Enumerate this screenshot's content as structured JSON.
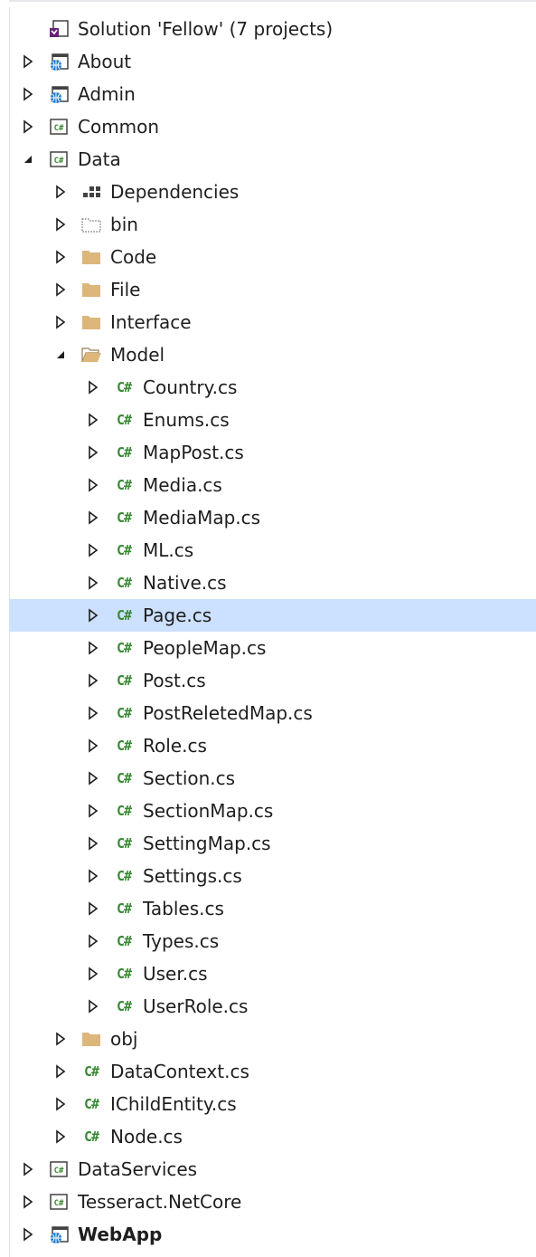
{
  "tree": {
    "items": [
      {
        "label": "Solution 'Fellow' (7 projects)",
        "level": 0,
        "expand": "none",
        "icon": "solution-icon",
        "bold": false,
        "selected": false
      },
      {
        "label": "About",
        "level": 0,
        "expand": "collapsed",
        "icon": "web-project-icon",
        "bold": false,
        "selected": false
      },
      {
        "label": "Admin",
        "level": 0,
        "expand": "collapsed",
        "icon": "web-project-icon",
        "bold": false,
        "selected": false
      },
      {
        "label": "Common",
        "level": 0,
        "expand": "collapsed",
        "icon": "csharp-project-icon",
        "bold": false,
        "selected": false
      },
      {
        "label": "Data",
        "level": 0,
        "expand": "expanded",
        "icon": "csharp-project-icon",
        "bold": false,
        "selected": false
      },
      {
        "label": "Dependencies",
        "level": 1,
        "expand": "collapsed",
        "icon": "dependencies-icon",
        "bold": false,
        "selected": false
      },
      {
        "label": "bin",
        "level": 1,
        "expand": "collapsed",
        "icon": "hidden-folder-icon",
        "bold": false,
        "selected": false
      },
      {
        "label": "Code",
        "level": 1,
        "expand": "collapsed",
        "icon": "folder-icon",
        "bold": false,
        "selected": false
      },
      {
        "label": "File",
        "level": 1,
        "expand": "collapsed",
        "icon": "folder-icon",
        "bold": false,
        "selected": false
      },
      {
        "label": "Interface",
        "level": 1,
        "expand": "collapsed",
        "icon": "folder-icon",
        "bold": false,
        "selected": false
      },
      {
        "label": "Model",
        "level": 1,
        "expand": "expanded",
        "icon": "folder-open-icon",
        "bold": false,
        "selected": false
      },
      {
        "label": "Country.cs",
        "level": 2,
        "expand": "collapsed",
        "icon": "csharp-file-icon",
        "bold": false,
        "selected": false
      },
      {
        "label": "Enums.cs",
        "level": 2,
        "expand": "collapsed",
        "icon": "csharp-file-icon",
        "bold": false,
        "selected": false
      },
      {
        "label": "MapPost.cs",
        "level": 2,
        "expand": "collapsed",
        "icon": "csharp-file-icon",
        "bold": false,
        "selected": false
      },
      {
        "label": "Media.cs",
        "level": 2,
        "expand": "collapsed",
        "icon": "csharp-file-icon",
        "bold": false,
        "selected": false
      },
      {
        "label": "MediaMap.cs",
        "level": 2,
        "expand": "collapsed",
        "icon": "csharp-file-icon",
        "bold": false,
        "selected": false
      },
      {
        "label": "ML.cs",
        "level": 2,
        "expand": "collapsed",
        "icon": "csharp-file-icon",
        "bold": false,
        "selected": false
      },
      {
        "label": "Native.cs",
        "level": 2,
        "expand": "collapsed",
        "icon": "csharp-file-icon",
        "bold": false,
        "selected": false
      },
      {
        "label": "Page.cs",
        "level": 2,
        "expand": "collapsed",
        "icon": "csharp-file-icon",
        "bold": false,
        "selected": true
      },
      {
        "label": "PeopleMap.cs",
        "level": 2,
        "expand": "collapsed",
        "icon": "csharp-file-icon",
        "bold": false,
        "selected": false
      },
      {
        "label": "Post.cs",
        "level": 2,
        "expand": "collapsed",
        "icon": "csharp-file-icon",
        "bold": false,
        "selected": false
      },
      {
        "label": "PostReletedMap.cs",
        "level": 2,
        "expand": "collapsed",
        "icon": "csharp-file-icon",
        "bold": false,
        "selected": false
      },
      {
        "label": "Role.cs",
        "level": 2,
        "expand": "collapsed",
        "icon": "csharp-file-icon",
        "bold": false,
        "selected": false
      },
      {
        "label": "Section.cs",
        "level": 2,
        "expand": "collapsed",
        "icon": "csharp-file-icon",
        "bold": false,
        "selected": false
      },
      {
        "label": "SectionMap.cs",
        "level": 2,
        "expand": "collapsed",
        "icon": "csharp-file-icon",
        "bold": false,
        "selected": false
      },
      {
        "label": "SettingMap.cs",
        "level": 2,
        "expand": "collapsed",
        "icon": "csharp-file-icon",
        "bold": false,
        "selected": false
      },
      {
        "label": "Settings.cs",
        "level": 2,
        "expand": "collapsed",
        "icon": "csharp-file-icon",
        "bold": false,
        "selected": false
      },
      {
        "label": "Tables.cs",
        "level": 2,
        "expand": "collapsed",
        "icon": "csharp-file-icon",
        "bold": false,
        "selected": false
      },
      {
        "label": "Types.cs",
        "level": 2,
        "expand": "collapsed",
        "icon": "csharp-file-icon",
        "bold": false,
        "selected": false
      },
      {
        "label": "User.cs",
        "level": 2,
        "expand": "collapsed",
        "icon": "csharp-file-icon",
        "bold": false,
        "selected": false
      },
      {
        "label": "UserRole.cs",
        "level": 2,
        "expand": "collapsed",
        "icon": "csharp-file-icon",
        "bold": false,
        "selected": false
      },
      {
        "label": "obj",
        "level": 1,
        "expand": "collapsed",
        "icon": "folder-icon",
        "bold": false,
        "selected": false
      },
      {
        "label": "DataContext.cs",
        "level": 1,
        "expand": "collapsed",
        "icon": "csharp-file-icon",
        "bold": false,
        "selected": false
      },
      {
        "label": "IChildEntity.cs",
        "level": 1,
        "expand": "collapsed",
        "icon": "csharp-file-icon",
        "bold": false,
        "selected": false
      },
      {
        "label": "Node.cs",
        "level": 1,
        "expand": "collapsed",
        "icon": "csharp-file-icon",
        "bold": false,
        "selected": false
      },
      {
        "label": "DataServices",
        "level": 0,
        "expand": "collapsed",
        "icon": "csharp-project-icon",
        "bold": false,
        "selected": false
      },
      {
        "label": "Tesseract.NetCore",
        "level": 0,
        "expand": "collapsed",
        "icon": "csharp-project-icon",
        "bold": false,
        "selected": false
      },
      {
        "label": "WebApp",
        "level": 0,
        "expand": "collapsed",
        "icon": "web-project-icon",
        "bold": true,
        "selected": false
      }
    ]
  },
  "colors": {
    "selection": "#cce0ff",
    "csharp_green": "#388a34",
    "folder": "#dcb67a",
    "text": "#1e1e1e",
    "vs_purple": "#68217a",
    "web_blue": "#1e7bd4"
  }
}
